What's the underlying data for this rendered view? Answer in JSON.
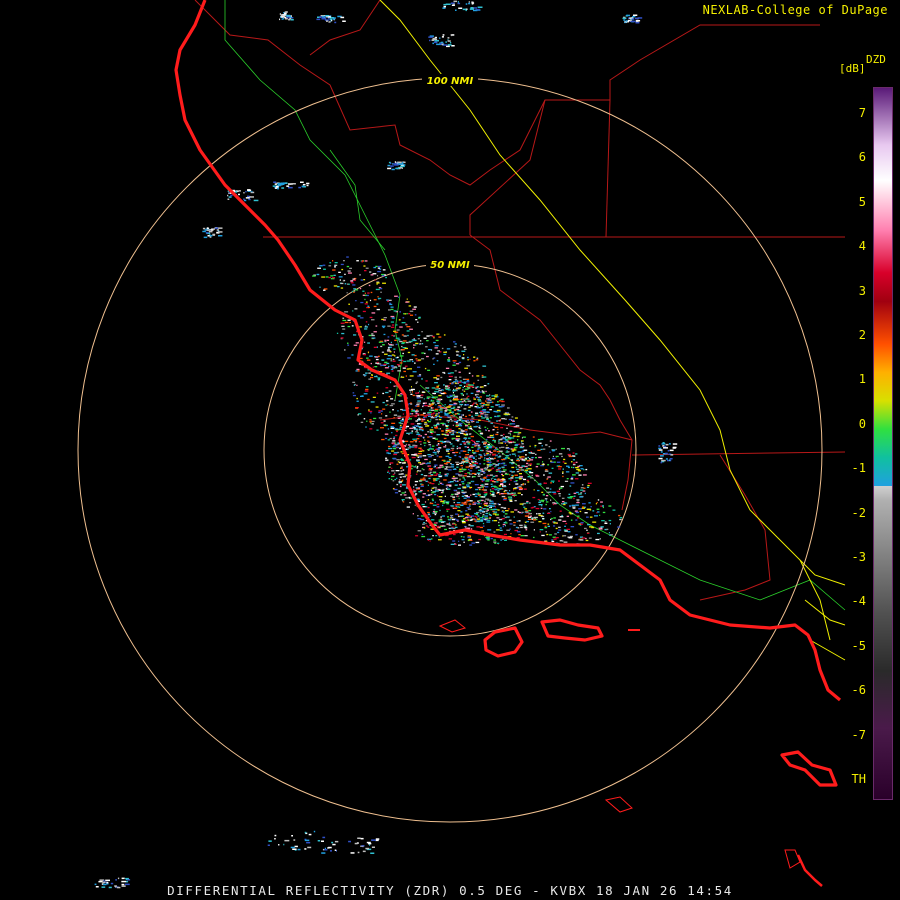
{
  "header": {
    "credit": "NEXLAB-College of DuPage"
  },
  "footer": {
    "caption": "DIFFERENTIAL REFLECTIVITY (ZDR) 0.5 DEG - KVBX 18 JAN 26 14:54"
  },
  "range_rings": [
    {
      "label": "100 NMI"
    },
    {
      "label": "50 NMI"
    }
  ],
  "legend": {
    "product": "DZD",
    "unit": "[dB]",
    "ticks": [
      "7",
      "6",
      "5",
      "4",
      "3",
      "2",
      "1",
      "0",
      "-1",
      "-2",
      "-3",
      "-4",
      "-5",
      "-6",
      "-7",
      "TH"
    ]
  },
  "colors": {
    "background": "#000000",
    "coastline": "#ff1c1c",
    "county_lines": "#b81818",
    "rivers": "#2bd02b",
    "highway": "#f0f000",
    "range_ring": "#f0c090",
    "label_text": "#f5f000"
  }
}
